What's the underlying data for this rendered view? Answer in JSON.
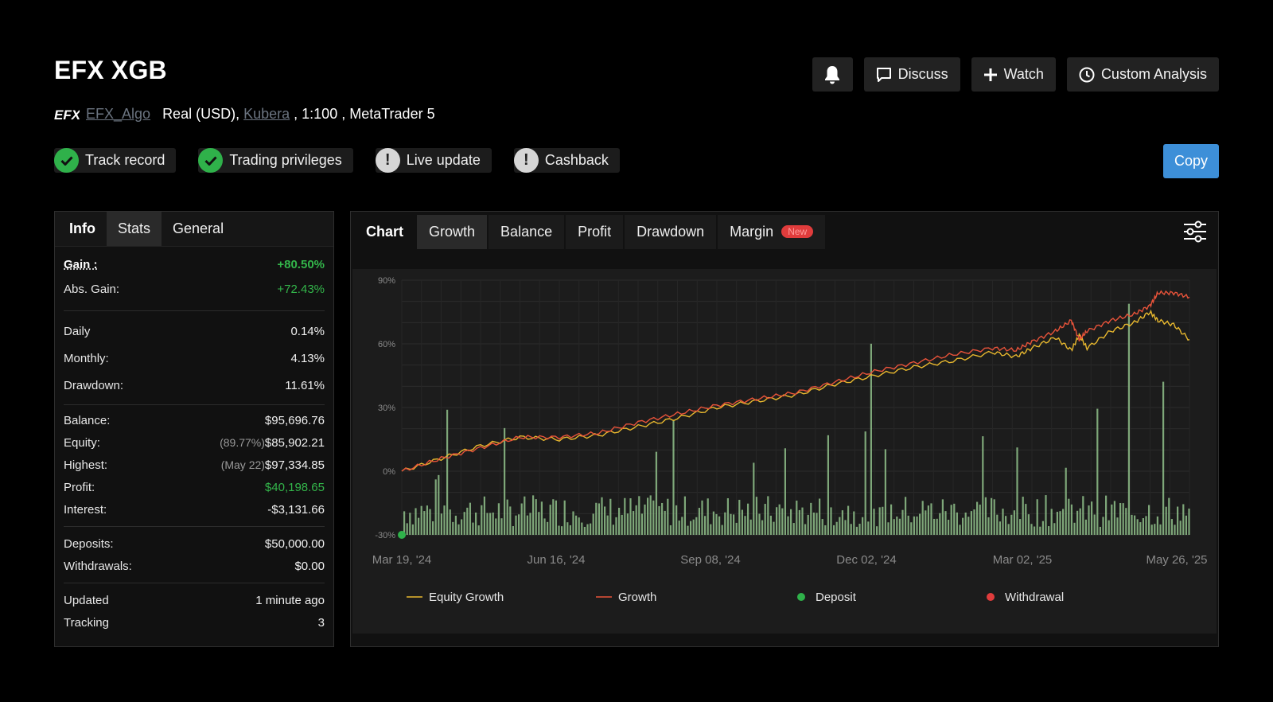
{
  "header": {
    "title": "EFX XGB",
    "broker_link": "EFX_Algo",
    "account_type": "Real (USD),",
    "server_link": "Kubera",
    "leverage": ", 1:100 , MetaTrader 5",
    "logo_text": "EFX"
  },
  "actions": {
    "bell_icon": "bell-icon",
    "discuss_label": "Discuss",
    "watch_label": "Watch",
    "custom_analysis_label": "Custom Analysis",
    "copy_label": "Copy"
  },
  "badges": [
    {
      "label": "Track record",
      "status": "ok"
    },
    {
      "label": "Trading privileges",
      "status": "ok"
    },
    {
      "label": "Live update",
      "status": "warn"
    },
    {
      "label": "Cashback",
      "status": "warn"
    }
  ],
  "left_tabs": [
    "Info",
    "Stats",
    "General"
  ],
  "stats": {
    "gain_label": "Gain :",
    "gain_value": "+80.50%",
    "abs_gain_label": "Abs. Gain:",
    "abs_gain_value": "+72.43%",
    "daily_label": "Daily",
    "daily_value": "0.14%",
    "monthly_label": "Monthly:",
    "monthly_value": "4.13%",
    "drawdown_label": "Drawdown:",
    "drawdown_value": "11.61%",
    "balance_label": "Balance:",
    "balance_value": "$95,696.76",
    "equity_label": "Equity:",
    "equity_sub": "(89.77%)",
    "equity_value": "$85,902.21",
    "highest_label": "Highest:",
    "highest_sub": "(May 22)",
    "highest_value": "$97,334.85",
    "profit_label": "Profit:",
    "profit_value": "$40,198.65",
    "interest_label": "Interest:",
    "interest_value": "-$3,131.66",
    "deposits_label": "Deposits:",
    "deposits_value": "$50,000.00",
    "withdrawals_label": "Withdrawals:",
    "withdrawals_value": "$0.00",
    "updated_label": "Updated",
    "updated_value": "1 minute ago",
    "tracking_label": "Tracking",
    "tracking_value": "3"
  },
  "chart_tabs": [
    "Chart",
    "Growth",
    "Balance",
    "Profit",
    "Drawdown",
    "Margin"
  ],
  "new_badge": "New",
  "colors": {
    "equity": "#e8b82e",
    "growth": "#e8533a",
    "deposit": "#2fb14a",
    "withdrawal": "#e03c3c",
    "bars": "#8fbf8a",
    "accent": "#3d8fd8"
  },
  "chart_data": {
    "type": "line",
    "x_ticks": [
      "Mar 19, '24",
      "Jun 16, '24",
      "Sep 08, '24",
      "Dec 02, '24",
      "Mar 02, '25",
      "May 26, '25"
    ],
    "y_ticks": [
      "90%",
      "60%",
      "30%",
      "0%",
      "-30%"
    ],
    "ylim": [
      -30,
      90
    ],
    "series": [
      {
        "name": "Equity Growth",
        "x": [
          0,
          0.05,
          0.1,
          0.15,
          0.2,
          0.25,
          0.3,
          0.35,
          0.4,
          0.45,
          0.5,
          0.55,
          0.6,
          0.65,
          0.7,
          0.75,
          0.78,
          0.8,
          0.83,
          0.85,
          0.86,
          0.87,
          0.9,
          0.93,
          0.95,
          0.96,
          0.98,
          1.0
        ],
        "values": [
          0,
          6,
          12,
          16,
          15,
          17,
          21,
          25,
          30,
          33,
          36,
          41,
          45,
          49,
          52,
          56,
          54,
          58,
          63,
          57,
          64,
          58,
          66,
          70,
          75,
          71,
          69,
          62
        ]
      },
      {
        "name": "Growth",
        "x": [
          0,
          0.05,
          0.1,
          0.15,
          0.2,
          0.25,
          0.3,
          0.35,
          0.4,
          0.45,
          0.5,
          0.55,
          0.6,
          0.65,
          0.7,
          0.75,
          0.78,
          0.8,
          0.83,
          0.85,
          0.86,
          0.87,
          0.9,
          0.93,
          0.95,
          0.96,
          0.98,
          1.0
        ],
        "values": [
          0,
          6,
          11,
          16,
          16,
          18,
          23,
          27,
          31,
          34,
          37,
          42,
          47,
          51,
          55,
          58,
          57,
          61,
          66,
          71,
          62,
          66,
          71,
          74,
          78,
          84,
          84,
          82
        ]
      }
    ],
    "markers": [
      {
        "name": "Deposit",
        "x": 0,
        "y": -30
      }
    ],
    "legend": [
      "Equity Growth",
      "Growth",
      "Deposit",
      "Withdrawal"
    ],
    "grid": true,
    "bars": "daily trade volume bars (unlabeled)"
  }
}
